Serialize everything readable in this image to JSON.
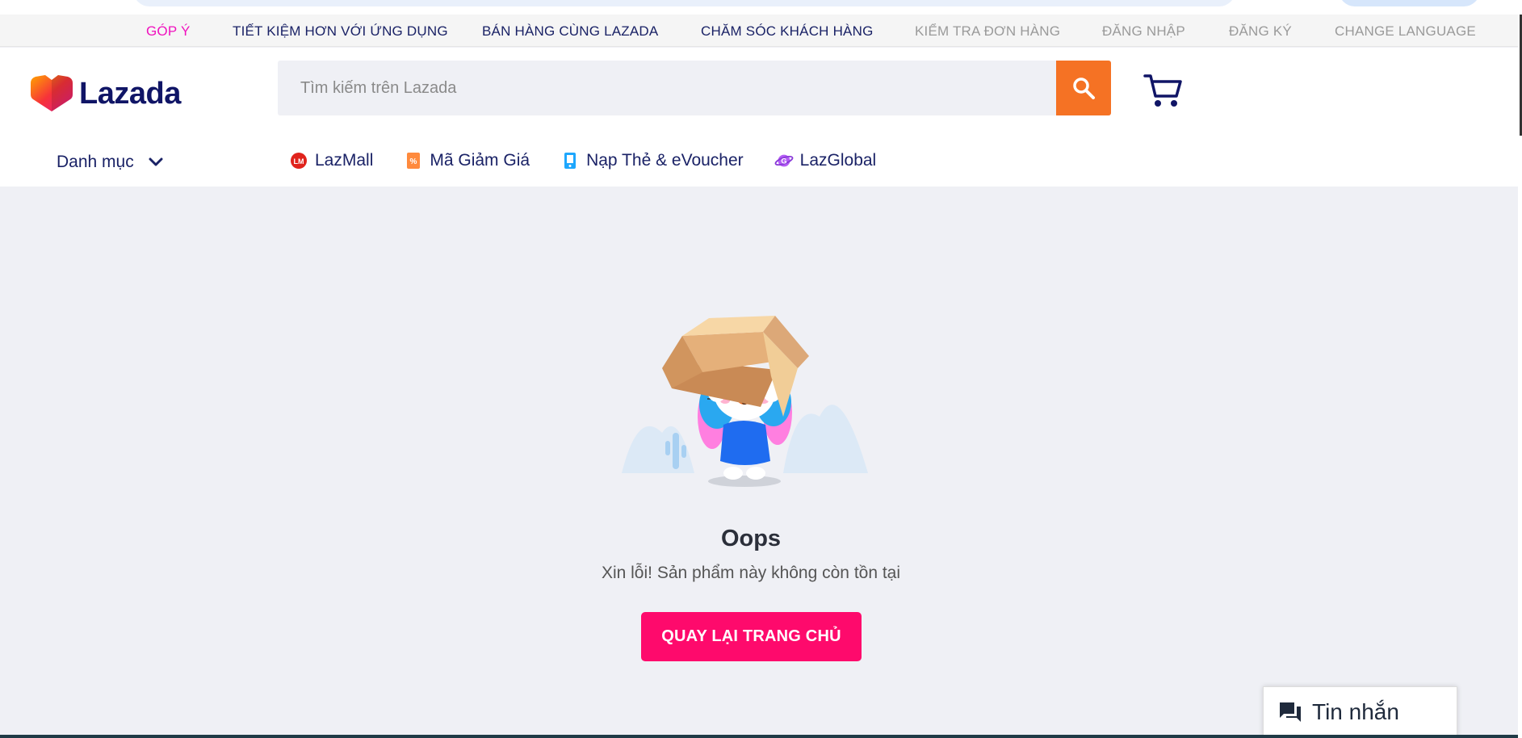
{
  "topbar": {
    "feedback": "GÓP Ý",
    "save_app": "TIẾT KIỆM HƠN VỚI ỨNG DỤNG",
    "sell": "BÁN HÀNG CÙNG LAZADA",
    "care": "CHĂM SÓC KHÁCH HÀNG",
    "track": "KIỂM TRA ĐƠN HÀNG",
    "login": "ĐĂNG NHẬP",
    "signup": "ĐĂNG KÝ",
    "language": "CHANGE LANGUAGE"
  },
  "header": {
    "logo_text": "Lazada",
    "search_placeholder": "Tìm kiếm trên Lazada",
    "categories_label": "Danh mục"
  },
  "nav": [
    {
      "label": "LazMall",
      "icon": "lazmall-icon"
    },
    {
      "label": "Mã Giảm Giá",
      "icon": "voucher-icon"
    },
    {
      "label": "Nạp Thẻ & eVoucher",
      "icon": "topup-icon"
    },
    {
      "label": "LazGlobal",
      "icon": "lazglobal-icon"
    }
  ],
  "error": {
    "title": "Oops",
    "message": "Xin lỗi! Sản phẩm này không còn tồn tại",
    "button": "QUAY LẠI TRANG CHỦ"
  },
  "chat": {
    "label": "Tin nhắn"
  },
  "colors": {
    "brand_orange": "#f57224",
    "brand_pink": "#fe0a6c",
    "brand_navy": "#101566",
    "feedback_pink": "#f012be"
  }
}
